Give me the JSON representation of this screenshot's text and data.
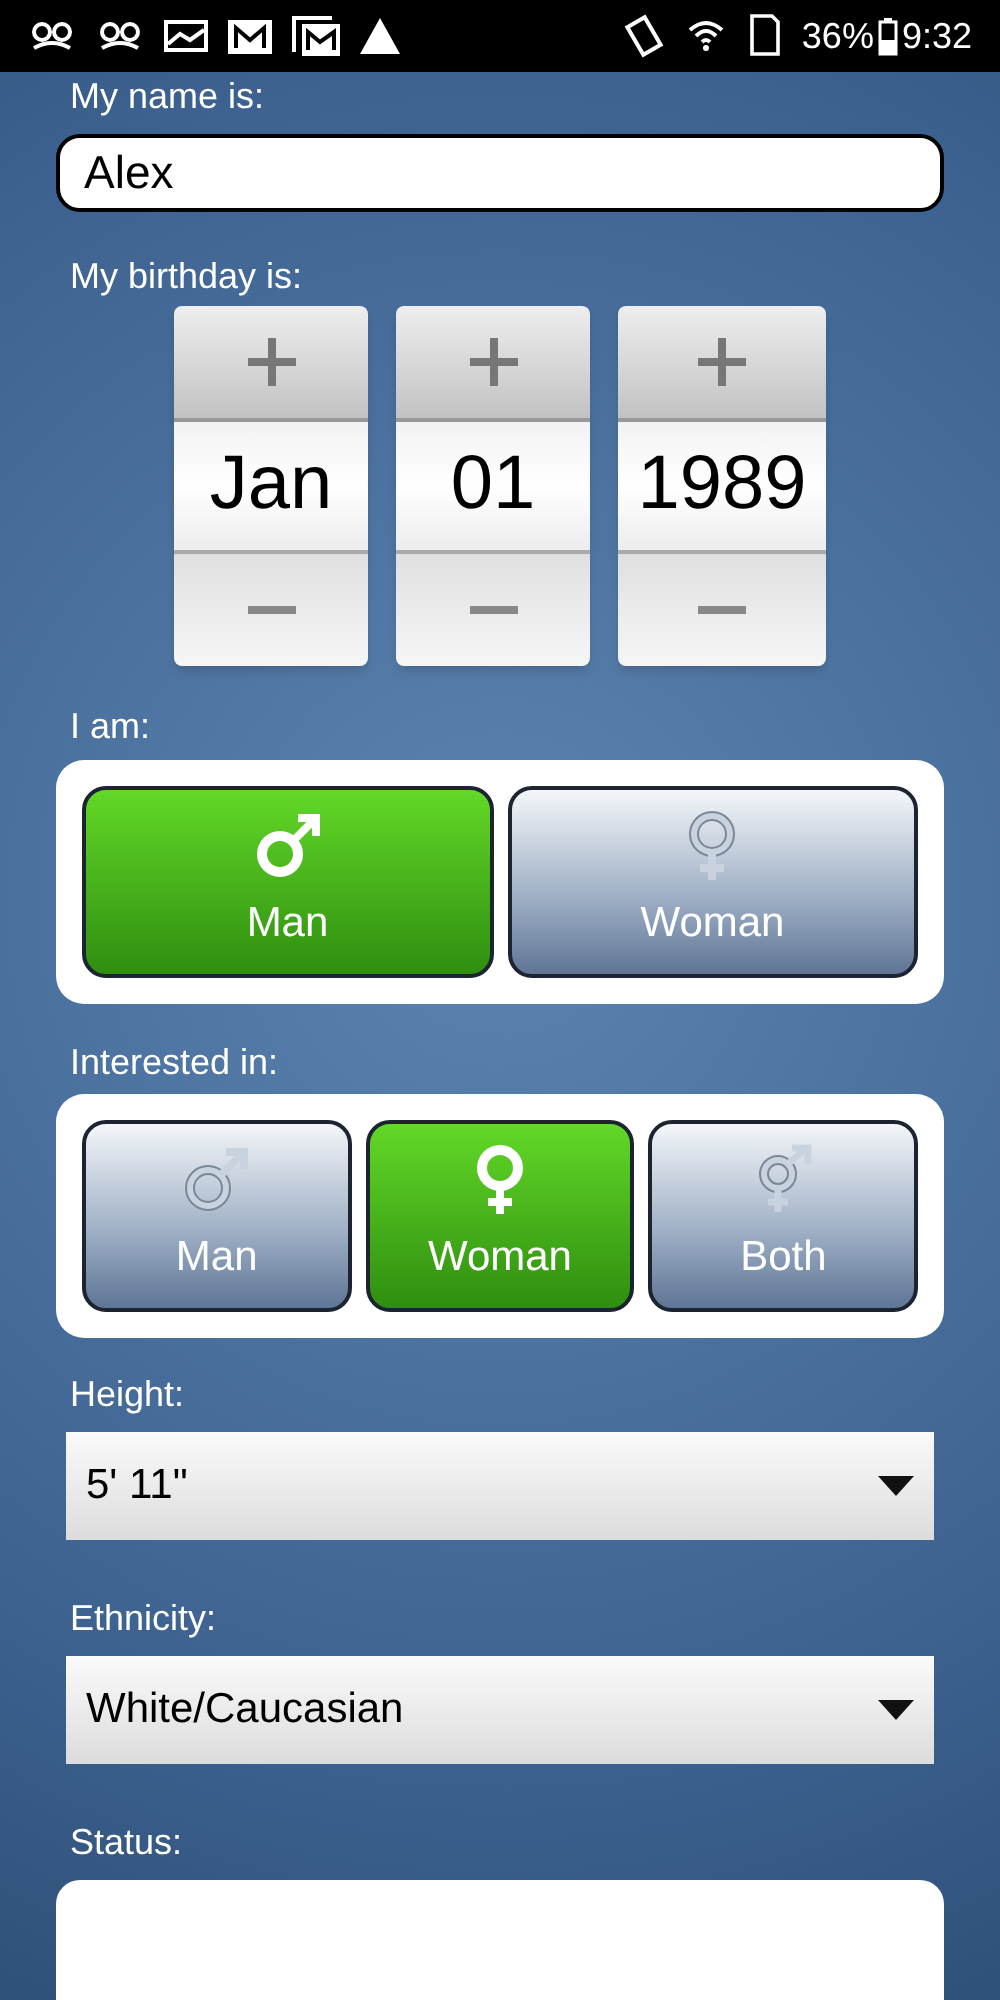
{
  "status_bar": {
    "battery": "36%",
    "time": "9:32"
  },
  "name": {
    "label": "My name is:",
    "value": "Alex"
  },
  "birthday": {
    "label": "My birthday is:",
    "spinners": [
      {
        "value": "Jan"
      },
      {
        "value": "01"
      },
      {
        "value": "1989"
      }
    ]
  },
  "i_am": {
    "label": "I am:",
    "options": [
      {
        "label": "Man",
        "kind": "male",
        "selected": true
      },
      {
        "label": "Woman",
        "kind": "female",
        "selected": false
      }
    ]
  },
  "interested_in": {
    "label": "Interested in:",
    "options": [
      {
        "label": "Man",
        "kind": "male",
        "selected": false
      },
      {
        "label": "Woman",
        "kind": "female",
        "selected": true
      },
      {
        "label": "Both",
        "kind": "both",
        "selected": false
      }
    ]
  },
  "height": {
    "label": "Height:",
    "value": "5' 11\""
  },
  "ethnicity": {
    "label": "Ethnicity:",
    "value": "White/Caucasian"
  },
  "status": {
    "label": "Status:"
  }
}
